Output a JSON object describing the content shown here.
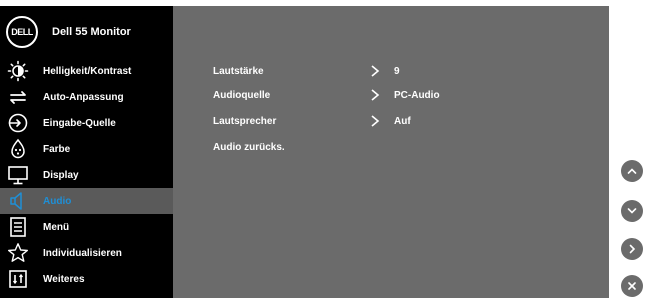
{
  "brand": {
    "logo_text": "DELL",
    "title": "Dell 55 Monitor"
  },
  "sidebar": {
    "items": [
      {
        "label": "Helligkeit/Kontrast",
        "icon": "brightness-icon"
      },
      {
        "label": "Auto-Anpassung",
        "icon": "auto-adjust-icon"
      },
      {
        "label": "Eingabe-Quelle",
        "icon": "input-source-icon"
      },
      {
        "label": "Farbe",
        "icon": "color-palette-icon"
      },
      {
        "label": "Display",
        "icon": "display-icon"
      },
      {
        "label": "Audio",
        "icon": "speaker-icon",
        "active": true
      },
      {
        "label": "Menü",
        "icon": "menu-icon"
      },
      {
        "label": "Individualisieren",
        "icon": "star-icon"
      },
      {
        "label": "Weiteres",
        "icon": "info-icon"
      }
    ]
  },
  "audio": {
    "rows": [
      {
        "label": "Lautstärke",
        "value": "9"
      },
      {
        "label": "Audioquelle",
        "value": "PC-Audio"
      },
      {
        "label": "Lautsprecher",
        "value": "Auf"
      },
      {
        "label": "Audio zurücks.",
        "value": ""
      }
    ]
  },
  "buttons": [
    {
      "icon": "chevron-up-icon"
    },
    {
      "icon": "chevron-down-icon"
    },
    {
      "icon": "chevron-right-icon"
    },
    {
      "icon": "exit-icon"
    }
  ],
  "colors": {
    "sidebar_bg": "#000000",
    "content_bg": "#6b6b6b",
    "active_bg": "#5a5a5a",
    "active_text": "#1f8fd6",
    "text": "#ffffff"
  }
}
